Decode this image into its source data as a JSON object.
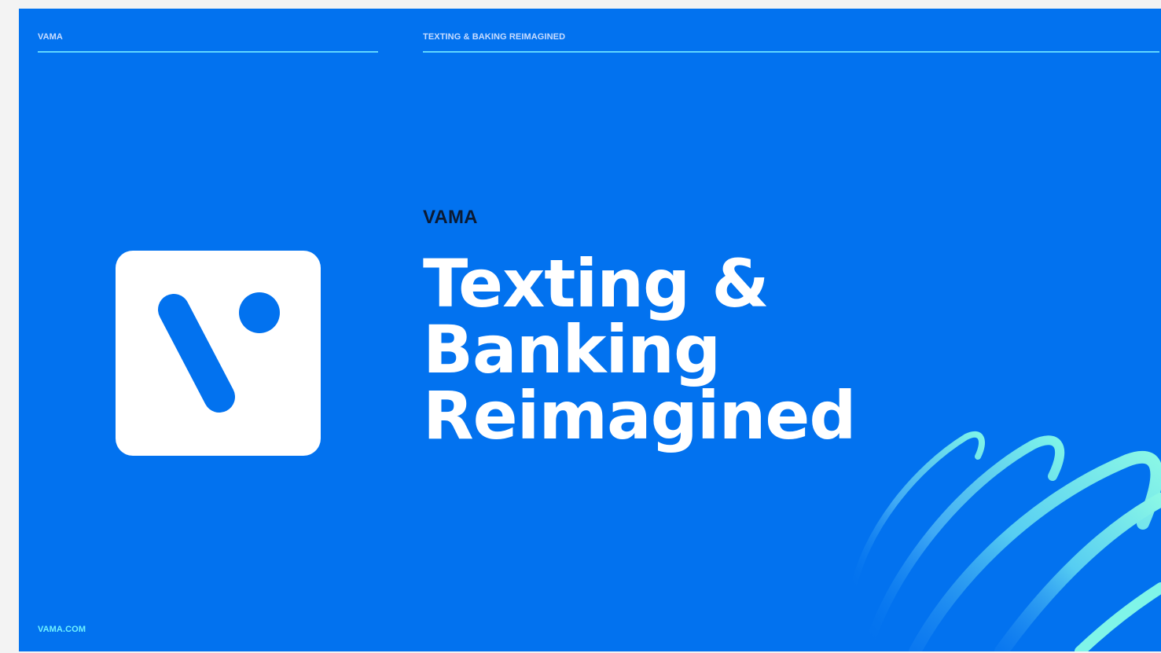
{
  "header": {
    "left_label": "VAMA",
    "right_label": "TEXTING & BAKING REIMAGINED"
  },
  "hero": {
    "eyebrow": "VAMA",
    "headline_lines": [
      "Texting &",
      "Banking",
      "Reimagined"
    ]
  },
  "logo": {
    "icon": "vama-v-logo-icon"
  },
  "footer": {
    "link_text": "VAMA.COM"
  },
  "colors": {
    "background": "#0272ef",
    "accent_line": "#5fd6ff",
    "swirl_light": "#7ff5e8",
    "swirl_blue": "#3fa9f5",
    "eyebrow_text": "#0b1a33",
    "footer_text": "#6ff2ff"
  }
}
